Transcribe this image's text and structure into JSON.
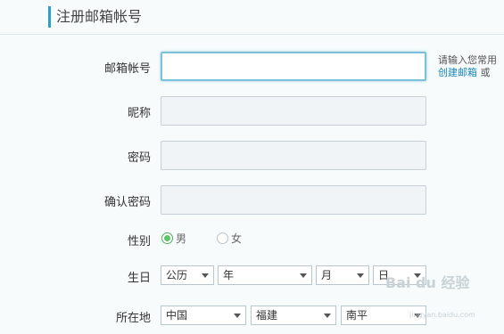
{
  "header": {
    "title": "注册邮箱帐号"
  },
  "form": {
    "email_label": "邮箱帐号",
    "nickname_label": "昵称",
    "password_label": "密码",
    "confirm_label": "确认密码",
    "gender_label": "性别",
    "birthday_label": "生日",
    "location_label": "所在地"
  },
  "hint": {
    "line1": "请输入您常用",
    "create_link": "创建邮箱",
    "or": "或"
  },
  "gender": {
    "male": "男",
    "female": "女",
    "selected": "male"
  },
  "birthday": {
    "calendar": "公历",
    "year": "年",
    "month": "月",
    "day": "日"
  },
  "location": {
    "country": "中国",
    "province": "福建",
    "city": "南平"
  },
  "watermark": {
    "brand": "Bai du 经验",
    "url": "jingyan.baidu.com"
  }
}
